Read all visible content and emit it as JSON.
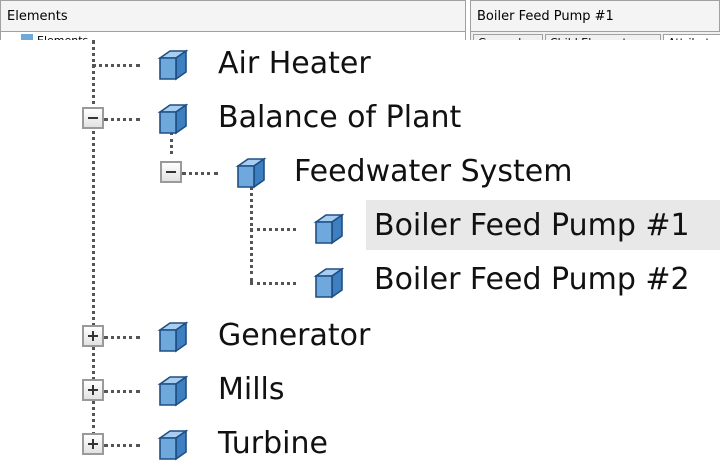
{
  "left_pane": {
    "title": "Elements",
    "root_label": "Elements"
  },
  "right_pane": {
    "title": "Boiler Feed Pump #1",
    "tabs": [
      "General",
      "Child Elements",
      "Attributes"
    ]
  },
  "tree": {
    "items": [
      {
        "label": "Air Heater",
        "expander": "none"
      },
      {
        "label": "Balance of Plant",
        "expander": "minus"
      },
      {
        "label": "Feedwater System",
        "expander": "minus"
      },
      {
        "label": "Boiler Feed Pump #1",
        "expander": "none",
        "selected": true
      },
      {
        "label": "Boiler Feed Pump #2",
        "expander": "none"
      },
      {
        "label": "Generator",
        "expander": "plus"
      },
      {
        "label": "Mills",
        "expander": "plus"
      },
      {
        "label": "Turbine",
        "expander": "plus"
      }
    ]
  },
  "colors": {
    "cube_face": "#6fa8dc",
    "cube_top": "#a9cdf0",
    "cube_side": "#3d7fc0",
    "selected": "#e8e8e8"
  }
}
